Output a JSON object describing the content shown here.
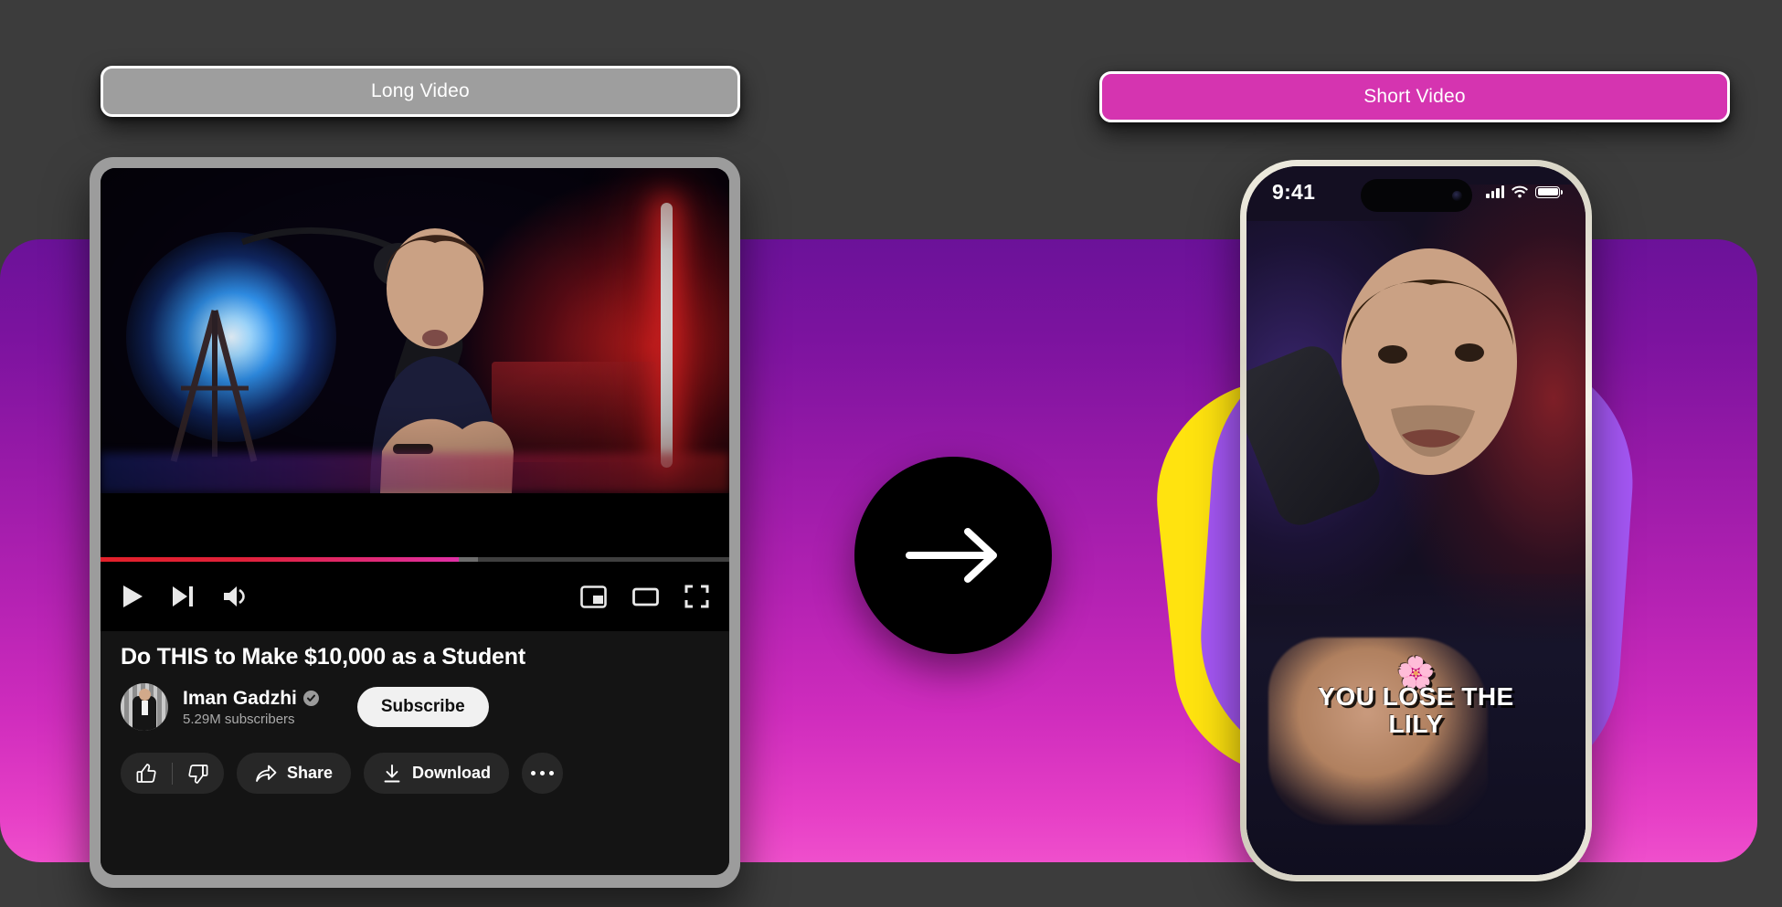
{
  "labels": {
    "long_video": "Long Video",
    "short_video": "Short Video"
  },
  "colors": {
    "page_bg": "#3c3c3c",
    "gradient_top": "#6b1299",
    "gradient_bottom": "#ef4fcc",
    "long_pill_bg": "#9e9e9e",
    "short_pill_bg": "#d534b0",
    "blob_yellow": "#ffe30f",
    "blob_purple": "#a557f5",
    "arrow_circle_bg": "#000000",
    "subscribe_bg": "#f1f1f1",
    "chip_bg": "#272727",
    "progress_played": "#e3202a"
  },
  "player": {
    "progress_percent": 57,
    "buffered_percent": 60,
    "controls_left": [
      {
        "name": "play-icon",
        "label": "Play"
      },
      {
        "name": "next-icon",
        "label": "Next"
      },
      {
        "name": "volume-icon",
        "label": "Volume"
      }
    ],
    "controls_right": [
      {
        "name": "picture-in-picture-icon",
        "label": "Miniplayer"
      },
      {
        "name": "theater-mode-icon",
        "label": "Theater mode"
      },
      {
        "name": "fullscreen-icon",
        "label": "Full screen"
      }
    ]
  },
  "video": {
    "title": "Do THIS to Make $10,000 as a Student",
    "channel_name": "Iman Gadzhi",
    "verified_badge": "verified-check-icon",
    "subscriber_count": "5.29M subscribers",
    "subscribe_label": "Subscribe",
    "actions": {
      "like": "like-icon",
      "dislike": "dislike-icon",
      "share_label": "Share",
      "download_label": "Download",
      "more_label": "More actions"
    }
  },
  "transition": {
    "arrow_icon": "arrow-right-icon"
  },
  "phone": {
    "status": {
      "time": "9:41",
      "cellular_icon": "cellular-bars-icon",
      "wifi_icon": "wifi-icon",
      "battery_icon": "battery-full-icon"
    },
    "caption": {
      "emoji": "🌸",
      "line1": "YOU LOSE THE",
      "line2": "LILY"
    }
  }
}
